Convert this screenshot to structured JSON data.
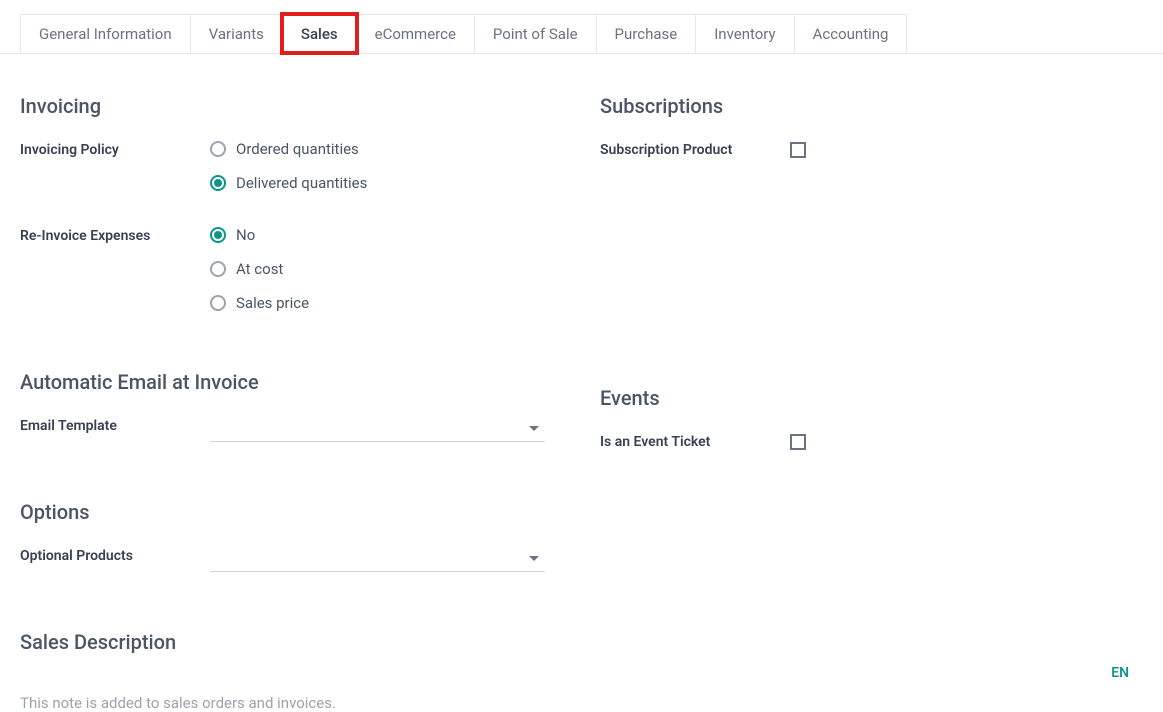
{
  "tabs": {
    "general_information": "General Information",
    "variants": "Variants",
    "sales": "Sales",
    "ecommerce": "eCommerce",
    "point_of_sale": "Point of Sale",
    "purchase": "Purchase",
    "inventory": "Inventory",
    "accounting": "Accounting"
  },
  "invoicing": {
    "title": "Invoicing",
    "policy_label": "Invoicing Policy",
    "policy_options": {
      "ordered": "Ordered quantities",
      "delivered": "Delivered quantities"
    },
    "reinvoice_label": "Re-Invoice Expenses",
    "reinvoice_options": {
      "no": "No",
      "at_cost": "At cost",
      "sales_price": "Sales price"
    }
  },
  "subscriptions": {
    "title": "Subscriptions",
    "product_label": "Subscription Product"
  },
  "auto_email": {
    "title": "Automatic Email at Invoice",
    "template_label": "Email Template"
  },
  "events": {
    "title": "Events",
    "ticket_label": "Is an Event Ticket"
  },
  "options": {
    "title": "Options",
    "products_label": "Optional Products"
  },
  "sales_description": {
    "title": "Sales Description",
    "placeholder": "This note is added to sales orders and invoices."
  },
  "lang": "EN"
}
